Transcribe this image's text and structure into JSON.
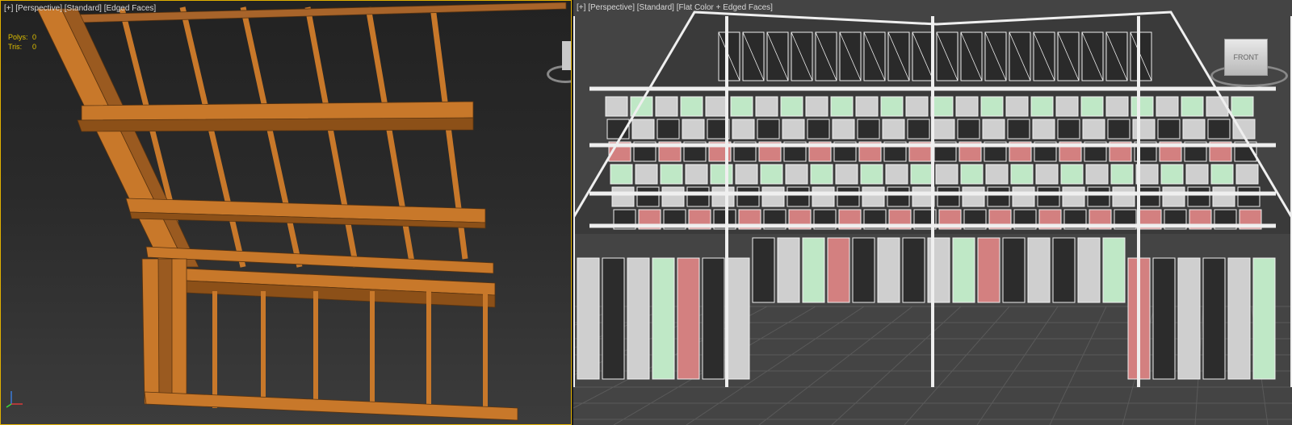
{
  "left_viewport": {
    "label": {
      "plus": "[+]",
      "view": "[Perspective]",
      "shading": "[Standard]",
      "display": "[Edged Faces]"
    },
    "stats": {
      "polys_label": "Polys:",
      "polys_value": "0",
      "tris_label": "Tris:",
      "tris_value": "0"
    },
    "active": true,
    "border_color": "#e0b000",
    "model_color": "#c8782a"
  },
  "right_viewport": {
    "label": {
      "plus": "[+]",
      "view": "[Perspective]",
      "shading": "[Standard]",
      "display": "[Flat Color + Edged Faces]"
    },
    "viewcube": {
      "face_label": "FRONT",
      "icon": "viewcube-icon"
    },
    "face_colors": {
      "white": "#cfcfcf",
      "dark": "#2c2c2c",
      "red": "#d38080",
      "green": "#bfe8c6",
      "wire": "#efefef"
    }
  }
}
